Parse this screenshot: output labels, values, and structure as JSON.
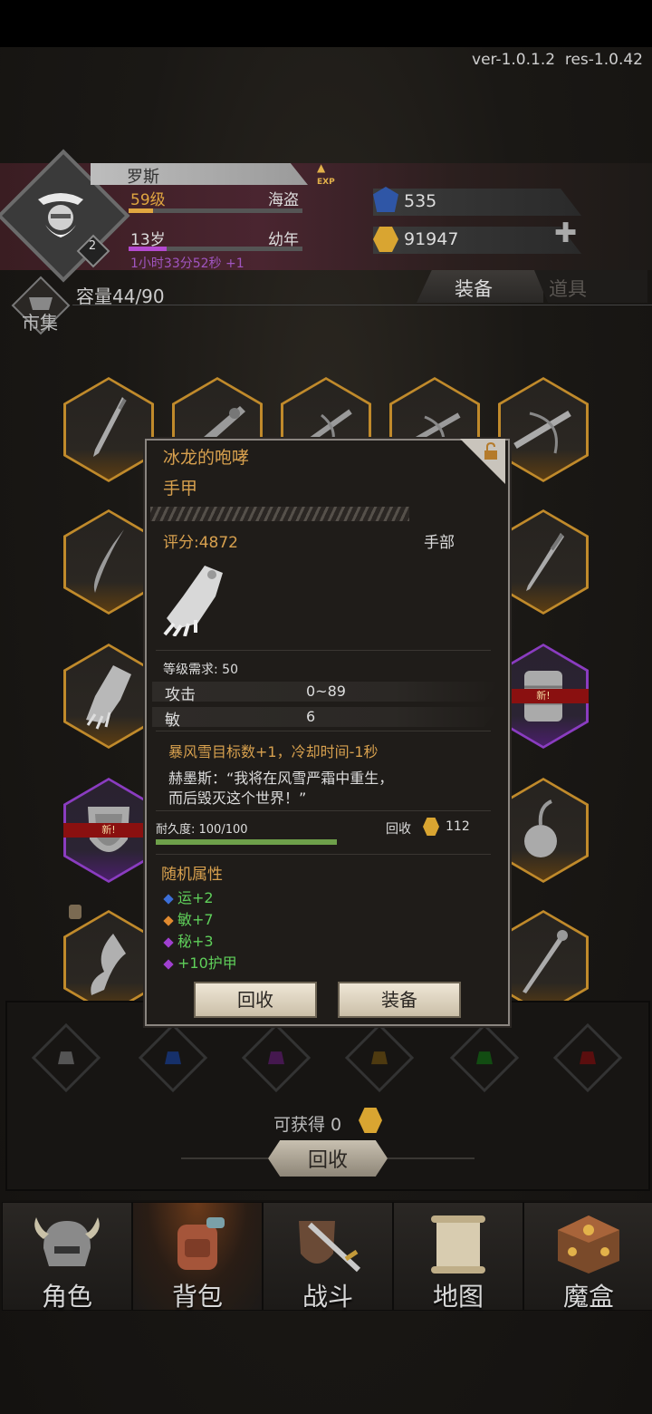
{
  "version": {
    "ver": "ver-1.0.1.2",
    "res": "res-1.0.42"
  },
  "player": {
    "name": "罗斯",
    "level": "59级",
    "class": "海盗",
    "age": "13岁",
    "stage": "幼年",
    "timer": "1小时33分52秒 +1",
    "badge": "2",
    "exp_label": "EXP",
    "level_progress": 0.14,
    "age_progress": 0.22
  },
  "currency": {
    "gems": "535",
    "gold": "91947"
  },
  "subbar": {
    "market": "市集",
    "capacity": "容量44/90",
    "tabs": [
      "装备",
      "道具"
    ]
  },
  "grid": {
    "new_label": "新!"
  },
  "popup": {
    "title": "冰龙的咆哮",
    "type": "手甲",
    "score": "评分:4872",
    "slot": "手部",
    "requirement": "等级需求: 50",
    "stats": [
      {
        "key": "攻击",
        "value": "0~89"
      },
      {
        "key": "敏",
        "value": "6"
      }
    ],
    "effect": "暴风雪目标数+1，冷却时间-1秒",
    "lore_line1": "赫墨斯：“我将在风雪严霜中重生，",
    "lore_line2": "而后毁灭这个世界！”",
    "durability": "耐久度: 100/100",
    "durability_fraction": 1.0,
    "recycle_label": "回收",
    "recycle_value": "112",
    "random_title": "随机属性",
    "random_attrs": [
      {
        "text": "运+2",
        "color": "#3c6fd8"
      },
      {
        "text": "敏+7",
        "color": "#e08a30"
      },
      {
        "text": "秘+3",
        "color": "#a040d0"
      },
      {
        "text": "+10护甲",
        "color": "#a040d0"
      }
    ],
    "btn_recycle": "回收",
    "btn_equip": "装备"
  },
  "recycle_panel": {
    "available": "可获得 0",
    "button": "回收",
    "bag_colors": [
      "#6b6b6b",
      "#2a4a9a",
      "#6a2a80",
      "#7a5a1a",
      "#2a7a2a",
      "#8a1a1a"
    ]
  },
  "nav": [
    {
      "label": "角色",
      "icon": "helmet-icon"
    },
    {
      "label": "背包",
      "icon": "backpack-icon"
    },
    {
      "label": "战斗",
      "icon": "sword-shield-icon"
    },
    {
      "label": "地图",
      "icon": "scroll-map-icon"
    },
    {
      "label": "魔盒",
      "icon": "magic-box-icon"
    }
  ]
}
